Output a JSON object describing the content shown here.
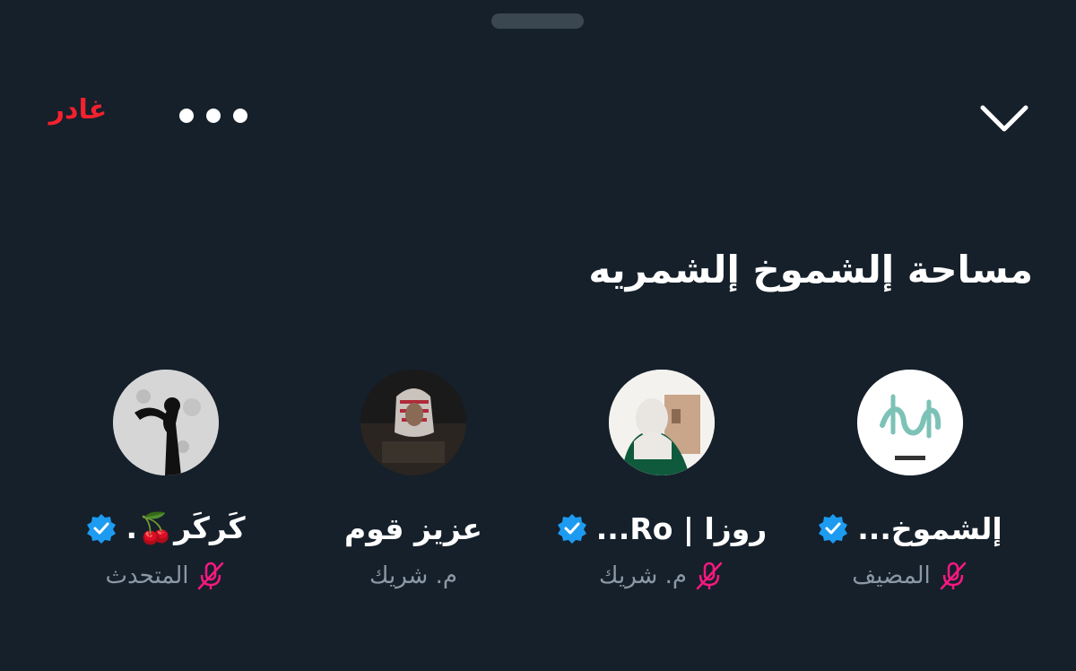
{
  "header": {
    "leave_label": "غادر",
    "more_icon": "more-horizontal-icon",
    "collapse_icon": "chevron-down-icon"
  },
  "space": {
    "title": "مساحة إلشموخ إلشمريه"
  },
  "participants": [
    {
      "name": "إلشموخ...",
      "role": "المضيف",
      "verified": true,
      "muted": true
    },
    {
      "name": "روزا | Ro...",
      "role": "م. شريك",
      "verified": true,
      "muted": true
    },
    {
      "name": "عزيز قوم",
      "role": "م. شريك",
      "verified": false,
      "muted": false
    },
    {
      "name": "كَركَر🍒.",
      "role": "المتحدث",
      "verified": true,
      "muted": true
    }
  ],
  "colors": {
    "background": "#15202b",
    "leave": "#f4212e",
    "verified": "#1d9bf0",
    "muted_mic": "#f91880",
    "secondary_text": "#8b98a5"
  }
}
